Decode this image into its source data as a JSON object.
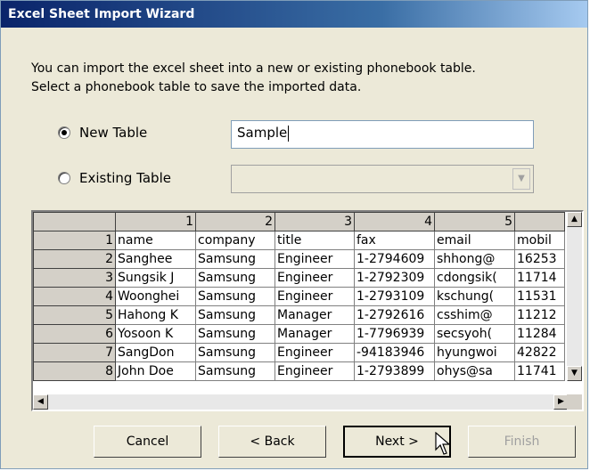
{
  "window": {
    "title": "Excel Sheet Import Wizard"
  },
  "description": {
    "line1": "You can import the excel sheet into a new or existing phonebook table.",
    "line2": "Select a phonebook table to save the imported data."
  },
  "options": {
    "new_table_label": "New Table",
    "new_table_selected": true,
    "new_table_value": "Sample",
    "existing_table_label": "Existing Table",
    "existing_table_value": ""
  },
  "grid": {
    "column_headers": [
      "",
      "1",
      "2",
      "3",
      "4",
      "5",
      ""
    ],
    "rows": [
      [
        "1",
        "name",
        "company",
        "title",
        "fax",
        "email",
        "mobil"
      ],
      [
        "2",
        "Sanghee",
        "Samsung",
        "Engineer",
        "1-2794609",
        "shhong@",
        "16253"
      ],
      [
        "3",
        "Sungsik J",
        "Samsung",
        "Engineer",
        "1-2792309",
        "cdongsik(",
        "11714"
      ],
      [
        "4",
        "Woonghei",
        "Samsung",
        "Engineer",
        "1-2793109",
        "kschung(",
        "11531"
      ],
      [
        "5",
        "Hahong K",
        "Samsung",
        "Manager",
        "1-2792616",
        "csshim@",
        "11212"
      ],
      [
        "6",
        "Yosoon K",
        "Samsung",
        "Manager",
        "1-7796939",
        "secsyoh(",
        "11284"
      ],
      [
        "7",
        "SangDon",
        "Samsung",
        "Engineer",
        "-94183946",
        "hyungwoi",
        "42822"
      ],
      [
        "8",
        "John Doe",
        "Samsung",
        "Engineer",
        "1-2793899",
        "ohys@sa",
        "11741"
      ]
    ]
  },
  "buttons": {
    "cancel": "Cancel",
    "back": "< Back",
    "next": "Next >",
    "finish": "Finish"
  },
  "icons": {
    "scroll_up": "▲",
    "scroll_down": "▼",
    "scroll_left": "◀",
    "scroll_right": "▶",
    "combo_arrow": "▼"
  }
}
